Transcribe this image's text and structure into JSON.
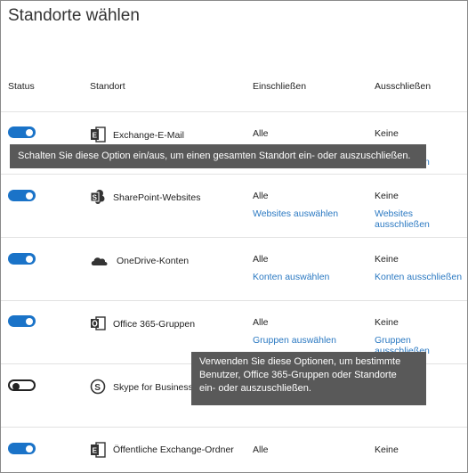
{
  "title": "Standorte wählen",
  "columns": {
    "status": "Status",
    "location": "Standort",
    "include": "Einschließen",
    "exclude": "Ausschließen"
  },
  "rows": [
    {
      "location": "Exchange-E-Mail",
      "icon": "exchange-icon",
      "toggle": "on",
      "include": "Alle",
      "exclude": "Keine",
      "include_link": "",
      "exclude_link": "Empfänger ausschließen"
    },
    {
      "location": "SharePoint-Websites",
      "icon": "sharepoint-icon",
      "toggle": "on",
      "include": "Alle",
      "exclude": "Keine",
      "include_link": "Websites auswählen",
      "exclude_link": "Websites ausschließen"
    },
    {
      "location": "OneDrive-Konten",
      "icon": "onedrive-icon",
      "toggle": "on",
      "include": "Alle",
      "exclude": "Keine",
      "include_link": "Konten auswählen",
      "exclude_link": "Konten ausschließen"
    },
    {
      "location": "Office 365-Gruppen",
      "icon": "outlook-groups-icon",
      "toggle": "on",
      "include": "Alle",
      "exclude": "Keine",
      "include_link": "Gruppen auswählen",
      "exclude_link": "Gruppen ausschließen"
    },
    {
      "location": "Skype for Business",
      "icon": "skype-icon",
      "toggle": "off",
      "include": "",
      "exclude": "",
      "include_link": "",
      "exclude_link": ""
    },
    {
      "location": "Öffentliche Exchange-Ordner",
      "icon": "exchange-icon",
      "toggle": "on",
      "include": "Alle",
      "exclude": "Keine",
      "include_link": "",
      "exclude_link": ""
    }
  ],
  "tooltips": {
    "toggle": "Schalten Sie diese Option ein/aus, um einen gesamten Standort ein- oder auszuschließen.",
    "options_line1": "Verwenden Sie diese Optionen, um bestimmte",
    "options_line2": "Benutzer, Office 365-Gruppen oder Standorte",
    "options_line3": "ein- oder auszuschließen."
  },
  "colors": {
    "accent": "#1a73c8",
    "link": "#2b79c2",
    "tooltip_bg": "#595959"
  }
}
